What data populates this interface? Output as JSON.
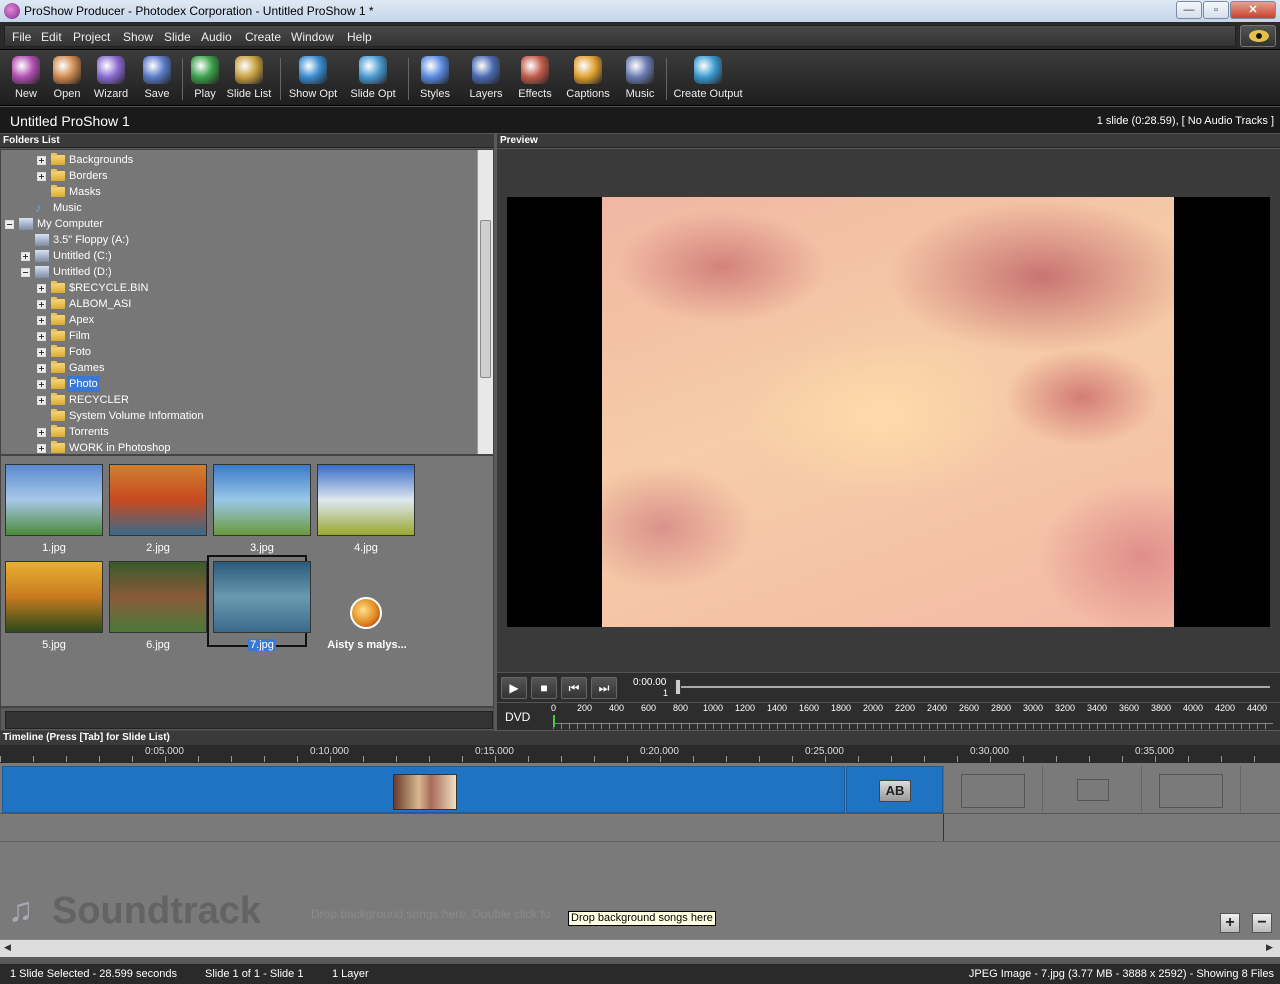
{
  "window": {
    "title": "ProShow Producer - Photodex Corporation - Untitled ProShow 1 *",
    "buttons": {
      "minimize": "—",
      "restore": "▫",
      "close": "✕"
    }
  },
  "menu": [
    "File",
    "Edit",
    "Project",
    "Show",
    "Slide",
    "Audio",
    "Create",
    "Window",
    "Help"
  ],
  "toolbar": {
    "items": [
      {
        "label": "New",
        "icon": "new-show-icon",
        "color": "#b04fb0"
      },
      {
        "label": "Open",
        "icon": "open-icon",
        "color": "#d08a50"
      },
      {
        "label": "Wizard",
        "icon": "wizard-icon",
        "color": "#8a6ad0"
      },
      {
        "label": "Save",
        "icon": "save-icon",
        "color": "#5a7ac8"
      },
      {
        "label": "Play",
        "icon": "play-icon",
        "color": "#3aa04a"
      },
      {
        "label": "Slide List",
        "icon": "slide-list-icon",
        "color": "#c8a040"
      },
      {
        "label": "Show Opt",
        "icon": "show-options-icon",
        "color": "#3a8ad0"
      },
      {
        "label": "Slide Opt",
        "icon": "slide-options-icon",
        "color": "#4a9ad0"
      },
      {
        "label": "Styles",
        "icon": "styles-icon",
        "color": "#5a8ae0"
      },
      {
        "label": "Layers",
        "icon": "layers-icon",
        "color": "#4a6ab0"
      },
      {
        "label": "Effects",
        "icon": "effects-icon",
        "color": "#c05a4a"
      },
      {
        "label": "Captions",
        "icon": "captions-icon",
        "color": "#e0a030"
      },
      {
        "label": "Music",
        "icon": "music-icon",
        "color": "#6a7ab0"
      },
      {
        "label": "Create Output",
        "icon": "create-output-icon",
        "color": "#3a9ad0"
      }
    ]
  },
  "project": {
    "title": "Untitled ProShow 1",
    "info": "1 slide (0:28.59), [ No Audio Tracks ]"
  },
  "folders": {
    "heading": "Folders List",
    "items": [
      {
        "label": "Backgrounds",
        "level": 2,
        "expander": "plus",
        "icon": "folder-icon"
      },
      {
        "label": "Borders",
        "level": 2,
        "expander": "plus",
        "icon": "folder-icon"
      },
      {
        "label": "Masks",
        "level": 2,
        "expander": "none",
        "icon": "folder-icon"
      },
      {
        "label": "Music",
        "level": 1,
        "expander": "none",
        "icon": "music-note-icon"
      },
      {
        "label": "My Computer",
        "level": 0,
        "expander": "minus",
        "icon": "computer-icon"
      },
      {
        "label": "3.5\" Floppy (A:)",
        "level": 1,
        "expander": "none",
        "icon": "floppy-icon"
      },
      {
        "label": "Untitled (C:)",
        "level": 1,
        "expander": "plus",
        "icon": "drive-icon"
      },
      {
        "label": "Untitled (D:)",
        "level": 1,
        "expander": "minus",
        "icon": "drive-icon"
      },
      {
        "label": "$RECYCLE.BIN",
        "level": 2,
        "expander": "plus",
        "icon": "folder-icon"
      },
      {
        "label": "ALBOM_ASI",
        "level": 2,
        "expander": "plus",
        "icon": "folder-icon"
      },
      {
        "label": "Apex",
        "level": 2,
        "expander": "plus",
        "icon": "folder-icon"
      },
      {
        "label": "Film",
        "level": 2,
        "expander": "plus",
        "icon": "folder-icon"
      },
      {
        "label": "Foto",
        "level": 2,
        "expander": "plus",
        "icon": "folder-icon"
      },
      {
        "label": "Games",
        "level": 2,
        "expander": "plus",
        "icon": "folder-icon"
      },
      {
        "label": "Photo",
        "level": 2,
        "expander": "plus",
        "icon": "folder-icon",
        "selected": true
      },
      {
        "label": "RECYCLER",
        "level": 2,
        "expander": "plus",
        "icon": "folder-icon"
      },
      {
        "label": "System Volume Information",
        "level": 2,
        "expander": "none",
        "icon": "folder-icon"
      },
      {
        "label": "Torrents",
        "level": 2,
        "expander": "plus",
        "icon": "folder-icon"
      },
      {
        "label": "WORK in Photoshop",
        "level": 2,
        "expander": "plus",
        "icon": "folder-icon"
      }
    ]
  },
  "files": [
    {
      "name": "1.jpg",
      "colors": [
        "#5a8ad0",
        "#a8c8e8",
        "#4a8a3a"
      ]
    },
    {
      "name": "2.jpg",
      "colors": [
        "#d08030",
        "#c84a20",
        "#3a6a8a"
      ]
    },
    {
      "name": "3.jpg",
      "colors": [
        "#3a7ac8",
        "#9ac8e8",
        "#6a9a3a"
      ]
    },
    {
      "name": "4.jpg",
      "colors": [
        "#3a6ac8",
        "#dde8f0",
        "#9aa830"
      ]
    },
    {
      "name": "5.jpg",
      "colors": [
        "#e8b030",
        "#c87a20",
        "#2a4a1a"
      ]
    },
    {
      "name": "6.jpg",
      "colors": [
        "#3a5a2a",
        "#8a5a3a",
        "#4a7a3a"
      ]
    },
    {
      "name": "7.jpg",
      "colors": [
        "#2a5a7a",
        "#6a9ab0",
        "#3a6a8a"
      ],
      "selected": true
    },
    {
      "name": "Aisty s malys...",
      "icon": "video-file-icon"
    }
  ],
  "preview": {
    "heading": "Preview"
  },
  "transport": {
    "time": "0:00.00",
    "slide": "1",
    "buttons": [
      "▶",
      "■",
      "⏮",
      "⏭"
    ]
  },
  "ruler": {
    "format": "DVD",
    "ticks": [
      "0",
      "200",
      "400",
      "600",
      "800",
      "1000",
      "1200",
      "1400",
      "1600",
      "1800",
      "2000",
      "2200",
      "2400",
      "2600",
      "2800",
      "3000",
      "3200",
      "3400",
      "3600",
      "3800",
      "4000",
      "4200",
      "4400"
    ]
  },
  "timeline": {
    "heading": "Timeline (Press [Tab] for Slide List)",
    "times": [
      "0:05.000",
      "0:10.000",
      "0:15.000",
      "0:20.000",
      "0:25.000",
      "0:30.000",
      "0:35.000"
    ],
    "transition_label": "AB",
    "soundtrack_title": "Soundtrack",
    "soundtrack_hint": "Drop background songs here.  Double click to",
    "tooltip": "Drop background songs here",
    "zoom_in": "+",
    "zoom_out": "−"
  },
  "status": {
    "selection": "1 Slide Selected - 28.599 seconds",
    "slide": "Slide 1 of 1 - Slide 1",
    "layers": "1 Layer",
    "file": "JPEG Image - 7.jpg (3.77 MB - 3888 x 2592) - Showing 8 Files"
  }
}
